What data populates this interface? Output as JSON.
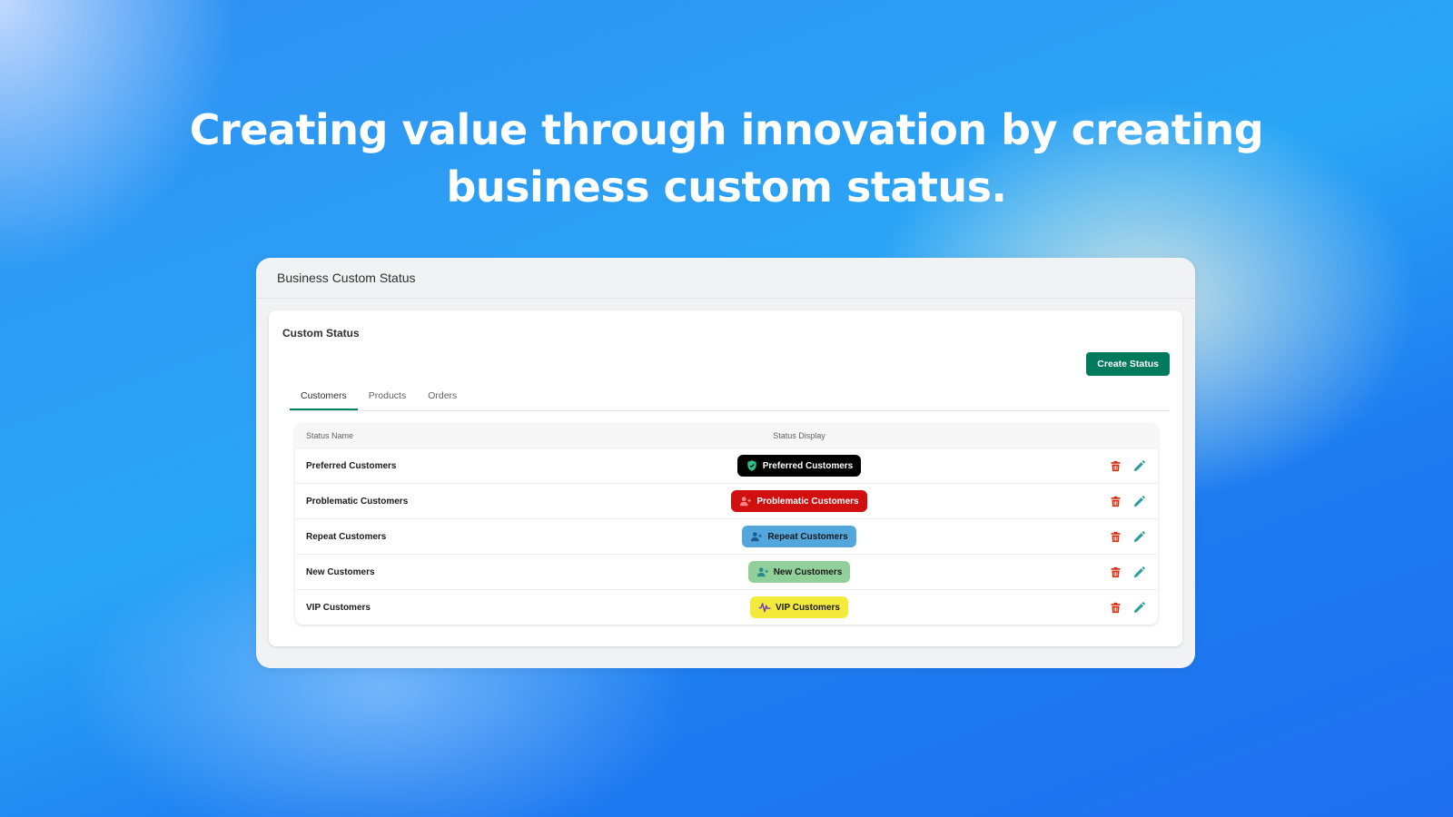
{
  "hero": {
    "line1": "Creating value through innovation by creating",
    "line2": "business custom status."
  },
  "window": {
    "title": "Business Custom Status"
  },
  "card": {
    "title": "Custom Status",
    "create_button": "Create Status"
  },
  "tabs": [
    {
      "label": "Customers",
      "active": true
    },
    {
      "label": "Products",
      "active": false
    },
    {
      "label": "Orders",
      "active": false
    }
  ],
  "table": {
    "headers": {
      "name": "Status Name",
      "display": "Status Display"
    },
    "rows": [
      {
        "name": "Preferred Customers",
        "badge": "Preferred Customers",
        "icon": "shield-check-icon",
        "bg": "#000000",
        "fg": "#ffffff",
        "icon_color": "#2fbf8f"
      },
      {
        "name": "Problematic Customers",
        "badge": "Problematic Customers",
        "icon": "user-plus-icon",
        "bg": "#d10f0f",
        "fg": "#ffffff",
        "icon_color": "#f08a8a"
      },
      {
        "name": "Repeat Customers",
        "badge": "Repeat Customers",
        "icon": "user-plus-icon",
        "bg": "#54a7dd",
        "fg": "#1a1a1a",
        "icon_color": "#1d5a8f"
      },
      {
        "name": "New Customers",
        "badge": "New Customers",
        "icon": "user-plus-icon",
        "bg": "#92d09a",
        "fg": "#1a1a1a",
        "icon_color": "#2a8c8c"
      },
      {
        "name": "VIP Customers",
        "badge": "VIP Customers",
        "icon": "activity-icon",
        "bg": "#f4ea3c",
        "fg": "#1a1a1a",
        "icon_color": "#6a3fb5"
      }
    ]
  },
  "colors": {
    "delete_icon": "#d82c0d",
    "edit_icon": "#2a9d9d",
    "accent": "#007a5c"
  }
}
